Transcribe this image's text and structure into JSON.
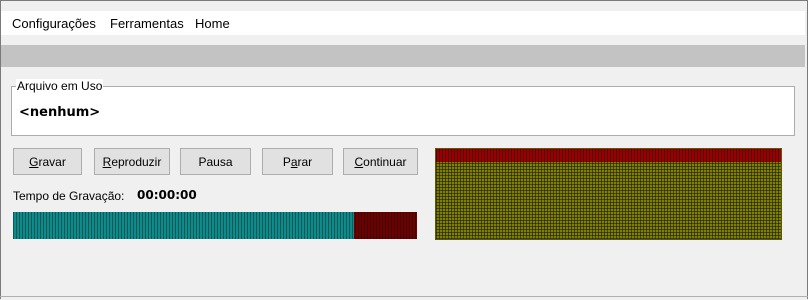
{
  "menu": {
    "items": [
      {
        "label": "Configurações"
      },
      {
        "label": "Ferramentas"
      },
      {
        "label": "Home"
      }
    ]
  },
  "file": {
    "legend": "Arquivo em Uso",
    "value": "<nenhum>"
  },
  "buttons": {
    "record": {
      "accel": "G",
      "rest": "ravar"
    },
    "play": {
      "accel": "R",
      "rest": "eproduzir"
    },
    "pause": {
      "label": "Pausa"
    },
    "stop": {
      "pre": "P",
      "accel": "a",
      "rest": "rar"
    },
    "continue": {
      "accel": "C",
      "rest": "ontinuar"
    }
  },
  "recording": {
    "label": "Tempo de Gravação:",
    "time": "00:00:00",
    "progress_fraction": 0.845
  },
  "colors": {
    "progress_fill": "#0f8a8a",
    "progress_empty": "#6a0000",
    "meter_body": "#7f7f00",
    "meter_peak": "#9a0000"
  }
}
